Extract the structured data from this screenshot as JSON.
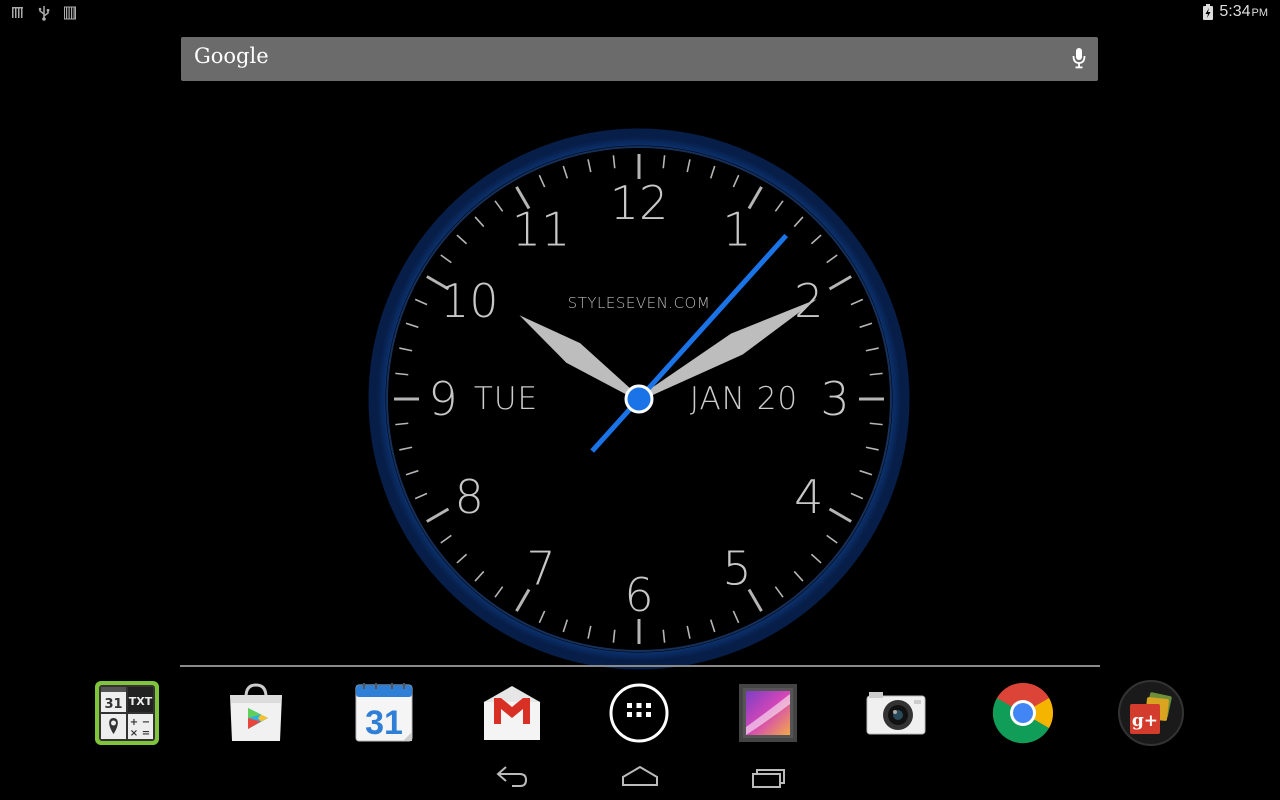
{
  "status_bar": {
    "left_icons": [
      "signal-bars-icon",
      "usb-icon",
      "sim-icon"
    ],
    "time": "5:34",
    "ampm": "PM",
    "battery_icon": "battery-charging-icon"
  },
  "search": {
    "label": "Google",
    "mic_icon": "microphone-icon",
    "background": "#6b6b6b"
  },
  "clock_widget": {
    "numerals": [
      "12",
      "1",
      "2",
      "3",
      "4",
      "5",
      "6",
      "7",
      "8",
      "9",
      "10",
      "11"
    ],
    "brand": "STYLESEVEN.COM",
    "day": "TUE",
    "date": "JAN 20",
    "time": {
      "hours": 10,
      "minutes": 10,
      "seconds": 7
    },
    "ring_color": "#0e3e86",
    "second_hand_color": "#1a74e8",
    "hand_color": "#bdbdbd"
  },
  "dock": {
    "items": [
      {
        "name": "tools-app",
        "icon": "calendar-txt-map-calc-icon",
        "calendar_text": "31",
        "txt_text": "TXT"
      },
      {
        "name": "play-store",
        "icon": "play-store-icon"
      },
      {
        "name": "calendar",
        "icon": "calendar-icon",
        "day_text": "31"
      },
      {
        "name": "gmail",
        "icon": "gmail-icon"
      },
      {
        "name": "all-apps",
        "icon": "app-drawer-icon"
      },
      {
        "name": "gallery",
        "icon": "gallery-icon"
      },
      {
        "name": "camera",
        "icon": "camera-icon"
      },
      {
        "name": "chrome",
        "icon": "chrome-icon"
      },
      {
        "name": "google-plus",
        "icon": "google-plus-icon",
        "text": "g+"
      }
    ]
  },
  "nav": {
    "back_icon": "back-icon",
    "home_icon": "home-icon",
    "recents_icon": "recents-icon"
  }
}
